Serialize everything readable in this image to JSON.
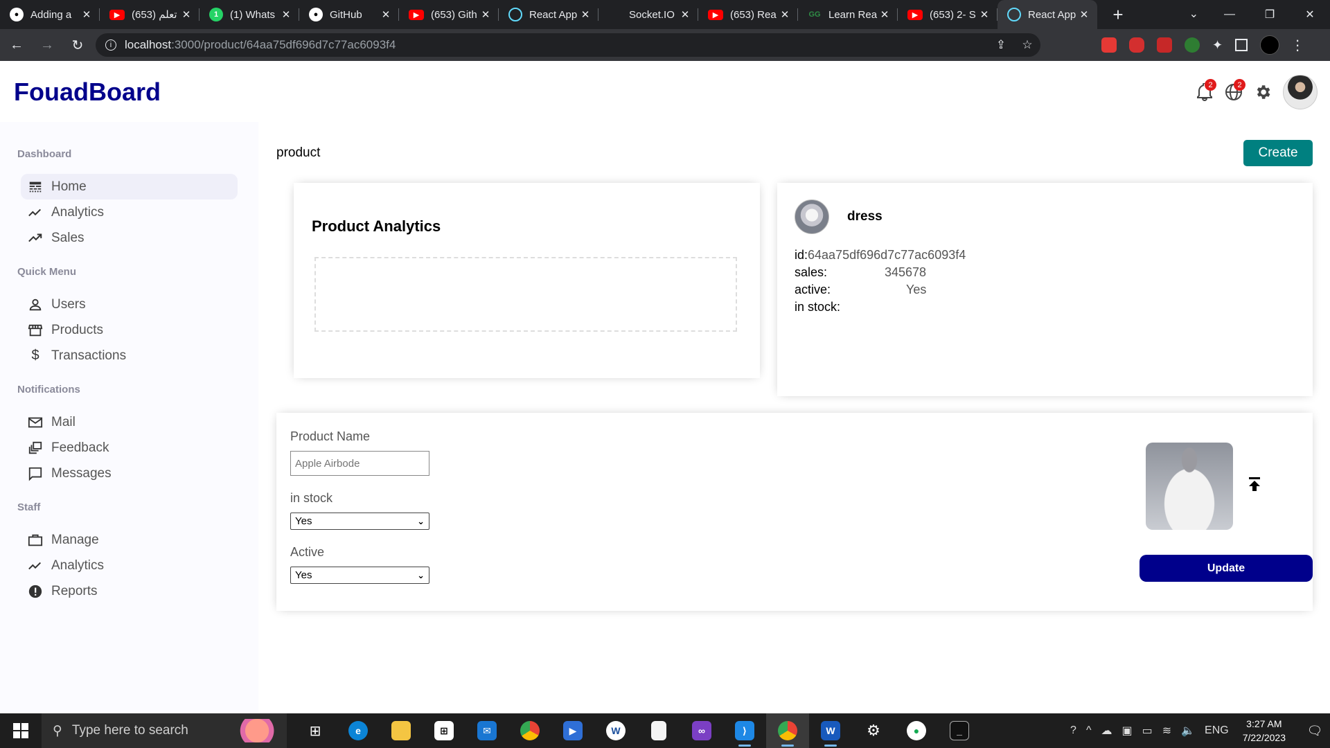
{
  "browser": {
    "tabs": [
      {
        "title": "Adding a",
        "favicon": "github-icon"
      },
      {
        "title": "تعلم (653)",
        "favicon": "youtube-icon"
      },
      {
        "title": "(1) Whats",
        "favicon": "whatsapp-icon"
      },
      {
        "title": "GitHub",
        "favicon": "github-icon"
      },
      {
        "title": "(653) Gith",
        "favicon": "youtube-icon"
      },
      {
        "title": "React App",
        "favicon": "react-icon"
      },
      {
        "title": "Socket.IO",
        "favicon": "none"
      },
      {
        "title": "(653) Rea",
        "favicon": "youtube-icon"
      },
      {
        "title": "Learn Rea",
        "favicon": "gfg-icon"
      },
      {
        "title": "(653) 2- S",
        "favicon": "youtube-icon"
      },
      {
        "title": "React App",
        "favicon": "react-icon",
        "active": true
      }
    ],
    "url_host": "localhost",
    "url_path": ":3000/product/64aa75df696d7c77ac6093f4"
  },
  "header": {
    "logo": "FouadBoard",
    "notifications_count": "2",
    "language_count": "2"
  },
  "sidebar": {
    "sections": [
      {
        "title": "Dashboard",
        "items": [
          {
            "label": "Home",
            "icon": "line-style-icon",
            "active": true
          },
          {
            "label": "Analytics",
            "icon": "timeline-icon"
          },
          {
            "label": "Sales",
            "icon": "trending-up-icon"
          }
        ]
      },
      {
        "title": "Quick Menu",
        "items": [
          {
            "label": "Users",
            "icon": "user-icon"
          },
          {
            "label": "Products",
            "icon": "storefront-icon"
          },
          {
            "label": "Transactions",
            "icon": "dollar-icon"
          }
        ]
      },
      {
        "title": "Notifications",
        "items": [
          {
            "label": "Mail",
            "icon": "mail-icon"
          },
          {
            "label": "Feedback",
            "icon": "dynamic-feed-icon"
          },
          {
            "label": "Messages",
            "icon": "chat-bubble-icon"
          }
        ]
      },
      {
        "title": "Staff",
        "items": [
          {
            "label": "Manage",
            "icon": "work-icon"
          },
          {
            "label": "Analytics",
            "icon": "timeline-icon"
          },
          {
            "label": "Reports",
            "icon": "report-icon"
          }
        ]
      }
    ]
  },
  "main": {
    "page_title": "product",
    "create_label": "Create",
    "analytics_title": "Product Analytics",
    "info": {
      "name": "dress",
      "rows": [
        {
          "key": "id:",
          "value": "64aa75df696d7c77ac6093f4"
        },
        {
          "key": "sales:",
          "value": "345678"
        },
        {
          "key": "active:",
          "value": "Yes"
        },
        {
          "key": "in stock:",
          "value": ""
        }
      ]
    },
    "form": {
      "name_label": "Product Name",
      "name_placeholder": "Apple Airbode",
      "stock_label": "in stock",
      "stock_value": "Yes",
      "active_label": "Active",
      "active_value": "Yes",
      "update_label": "Update"
    }
  },
  "taskbar": {
    "search_placeholder": "Type here to search",
    "language": "ENG",
    "time": "3:27 AM",
    "date": "7/22/2023"
  }
}
